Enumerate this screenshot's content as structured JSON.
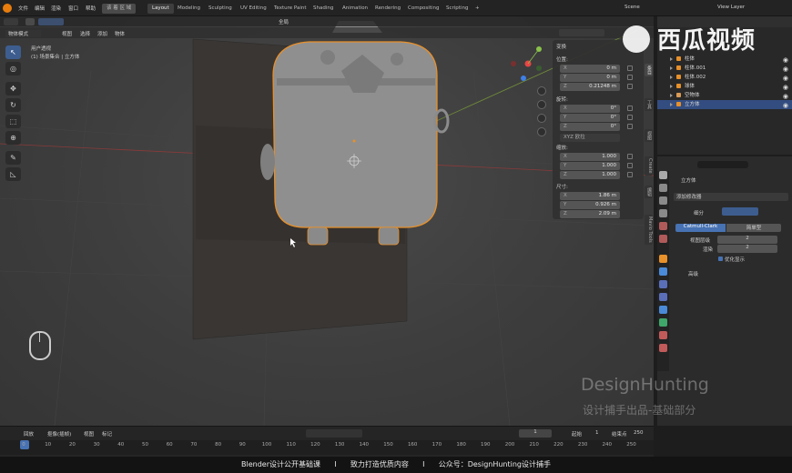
{
  "topbar": {
    "menus": [
      "文件",
      "编辑",
      "渲染",
      "窗口",
      "帮助"
    ],
    "tool_label": "该 着 区 域",
    "workspaces": [
      "Layout",
      "Modeling",
      "Sculpting",
      "UV Editing",
      "Texture Paint",
      "Shading",
      "Animation",
      "Rendering",
      "Compositing",
      "Scripting"
    ],
    "add_tab": "+",
    "scene": "Scene",
    "view_layer": "View Layer"
  },
  "viewport": {
    "mode": "物体模式",
    "menus": [
      "视图",
      "选择",
      "添加",
      "物体"
    ],
    "pivot": "全局",
    "info_line1": "用户透视",
    "info_line2": "(1) 场景集合 | 立方体"
  },
  "npanel": {
    "header": "变换",
    "location_label": "位置:",
    "location": [
      {
        "axis": "X",
        "value": "0 m"
      },
      {
        "axis": "Y",
        "value": "0 m"
      },
      {
        "axis": "Z",
        "value": "0.21248 m"
      }
    ],
    "rotation_label": "旋转:",
    "rotation": [
      {
        "axis": "X",
        "value": "0°"
      },
      {
        "axis": "Y",
        "value": "0°"
      },
      {
        "axis": "Z",
        "value": "0°"
      }
    ],
    "rotation_mode": "XYZ 欧拉",
    "scale_label": "缩放:",
    "scale": [
      {
        "axis": "X",
        "value": "1.000"
      },
      {
        "axis": "Y",
        "value": "1.000"
      },
      {
        "axis": "Z",
        "value": "1.000"
      }
    ],
    "dimensions_label": "尺寸:",
    "dimensions": [
      {
        "axis": "X",
        "value": "1.86 m"
      },
      {
        "axis": "Y",
        "value": "0.926 m"
      },
      {
        "axis": "Z",
        "value": "2.09 m"
      }
    ]
  },
  "side_tabs": [
    "条目",
    "工具",
    "视图",
    "Create",
    "编辑",
    "Mavio Tools"
  ],
  "outliner": {
    "items": [
      "柱体",
      "柱体.001",
      "柱体.002",
      "球体",
      "空物体",
      "立方体"
    ]
  },
  "properties": {
    "object_name": "立方体",
    "add_modifier": "添加修改器",
    "modifier_name": "细分",
    "catmull": "Catmull-Clark",
    "simple": "简单型",
    "levels_viewport_label": "视图层级",
    "levels_viewport": "2",
    "render_label": "渲染",
    "render_value": "2",
    "optimal_label": "优化显示",
    "advanced_label": "高级"
  },
  "timeline": {
    "menus": [
      "回放",
      "抠像(插帧)",
      "视图",
      "标记"
    ],
    "current_frame": "1",
    "start_label": "起始",
    "start": "1",
    "end_label": "结束点",
    "end": "250",
    "ticks": [
      "0",
      "10",
      "20",
      "30",
      "40",
      "50",
      "60",
      "70",
      "80",
      "90",
      "100",
      "110",
      "120",
      "130",
      "140",
      "150",
      "160",
      "170",
      "180",
      "190",
      "200",
      "210",
      "220",
      "230",
      "240",
      "250"
    ]
  },
  "watermark": {
    "brand": "西瓜视频",
    "dh": "DesignHunting",
    "dh_sub": "设计捕手出品-基础部分"
  },
  "subtitle": "Blender设计公开基础课      I      致力打造优质内容      I      公众号：DesignHunting设计捕手"
}
